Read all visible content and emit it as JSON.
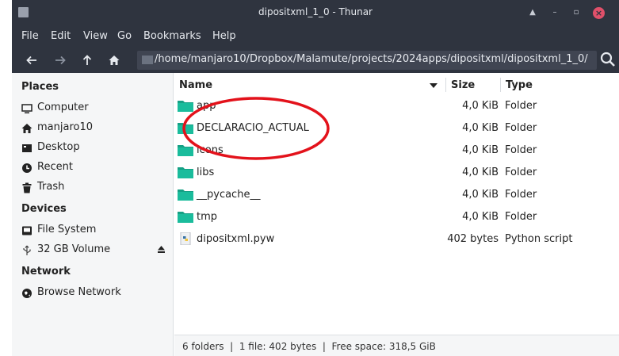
{
  "window": {
    "title": "dipositxml_1_0 - Thunar"
  },
  "menubar": {
    "items": [
      "File",
      "Edit",
      "View",
      "Go",
      "Bookmarks",
      "Help"
    ]
  },
  "location": {
    "path": "/home/manjaro10/Dropbox/Malamute/projects/2024apps/dipositxml/dipositxml_1_0/"
  },
  "sidebar": {
    "places_heading": "Places",
    "places": [
      {
        "label": "Computer",
        "icon": "computer-icon"
      },
      {
        "label": "manjaro10",
        "icon": "home-icon"
      },
      {
        "label": "Desktop",
        "icon": "desktop-icon"
      },
      {
        "label": "Recent",
        "icon": "recent-icon"
      },
      {
        "label": "Trash",
        "icon": "trash-icon"
      }
    ],
    "devices_heading": "Devices",
    "devices": [
      {
        "label": "File System",
        "icon": "drive-icon"
      },
      {
        "label": "32 GB Volume",
        "icon": "usb-icon"
      }
    ],
    "network_heading": "Network",
    "network": [
      {
        "label": "Browse Network",
        "icon": "network-icon"
      }
    ]
  },
  "list": {
    "columns": {
      "name": "Name",
      "size": "Size",
      "type": "Type"
    },
    "rows": [
      {
        "name": "app",
        "size": "4,0 KiB",
        "type": "Folder",
        "kind": "folder"
      },
      {
        "name": "DECLARACIO_ACTUAL",
        "size": "4,0 KiB",
        "type": "Folder",
        "kind": "folder"
      },
      {
        "name": "icons",
        "size": "4,0 KiB",
        "type": "Folder",
        "kind": "folder"
      },
      {
        "name": "libs",
        "size": "4,0 KiB",
        "type": "Folder",
        "kind": "folder"
      },
      {
        "name": "__pycache__",
        "size": "4,0 KiB",
        "type": "Folder",
        "kind": "folder"
      },
      {
        "name": "tmp",
        "size": "4,0 KiB",
        "type": "Folder",
        "kind": "folder"
      },
      {
        "name": "dipositxml.pyw",
        "size": "402 bytes",
        "type": "Python script",
        "kind": "python"
      }
    ]
  },
  "statusbar": {
    "text": "6 folders  |  1 file: 402 bytes  |  Free space: 318,5 GiB"
  },
  "colors": {
    "titlebar": "#2f343f",
    "folder": "#16a085",
    "annotation": "#e3121b",
    "close": "#e0506a"
  }
}
